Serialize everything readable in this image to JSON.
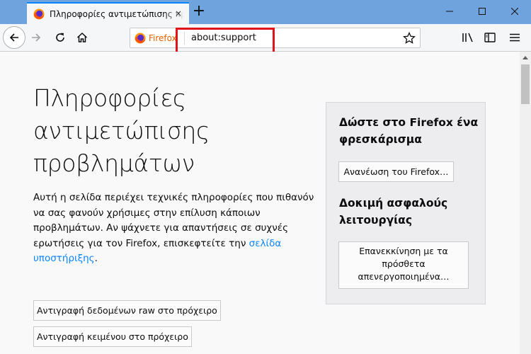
{
  "tab": {
    "title": "Πληροφορίες αντιμετώπισης προβλημάτων",
    "close_icon": "×",
    "new_tab_icon": "+"
  },
  "window_controls": {
    "minimize": "minimize-icon",
    "maximize": "maximize-icon",
    "close": "close-icon"
  },
  "urlbar": {
    "identity_label": "Firefox",
    "url": "about:support"
  },
  "page": {
    "title": "Πληροφορίες αντιμετώπισης προβλημάτων",
    "intro_text": "Αυτή η σελίδα περιέχει τεχνικές πληροφορίες που πιθανόν να σας φανούν χρήσιμες στην επίλυση κάποιων προβλημάτων. Αν ψάχνετε για απαντήσεις σε συχνές ερωτήσεις για τον Firefox, επισκεφτείτε την ",
    "support_link": "σελίδα υποστήριξης",
    "intro_end": ".",
    "copy_raw_button": "Αντιγραφή δεδομένων raw στο πρόχειρο",
    "copy_text_button": "Αντιγραφή κειμένου στο πρόχειρο"
  },
  "sidebar": {
    "refresh_heading": "Δώστε στο Firefox ένα φρεσκάρισμα",
    "refresh_button": "Ανανέωση του Firefox…",
    "safe_mode_heading": "Δοκιμή ασφαλούς λειτουργίας",
    "safe_mode_button": "Επανεκκίνηση με τα πρόσθετα απενεργοποιημένα…"
  },
  "colors": {
    "tabbar": "#6fa3dd",
    "accent": "#0a84ff",
    "highlight": "#e0121a",
    "firefox_orange": "#e66000"
  }
}
